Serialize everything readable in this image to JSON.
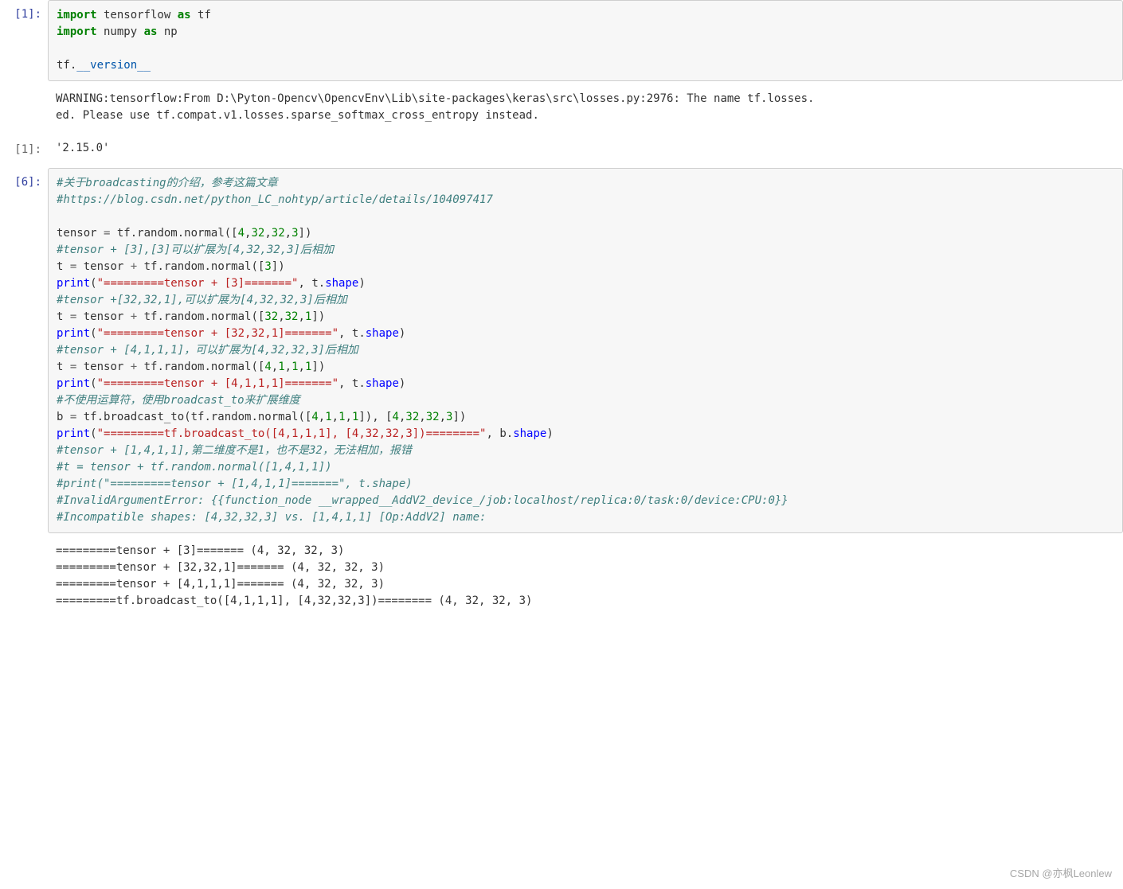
{
  "cells": {
    "c1": {
      "prompt": "[1]:",
      "code": {
        "line1_import": "import",
        "line1_mod": " tensorflow ",
        "line1_as": "as",
        "line1_alias": " tf",
        "line2_import": "import",
        "line2_mod": " numpy ",
        "line2_as": "as",
        "line2_alias": " np",
        "line3_obj": "tf.",
        "line3_dunder": "__version__"
      },
      "stream_output": "WARNING:tensorflow:From D:\\Pyton-Opencv\\OpencvEnv\\Lib\\site-packages\\keras\\src\\losses.py:2976: The name tf.losses.\ned. Please use tf.compat.v1.losses.sparse_softmax_cross_entropy instead.",
      "out_prompt": "[1]:",
      "result": "'2.15.0'"
    },
    "c6": {
      "prompt": "[6]:",
      "out_text": "=========tensor + [3]======= (4, 32, 32, 3)\n=========tensor + [32,32,1]======= (4, 32, 32, 3)\n=========tensor + [4,1,1,1]======= (4, 32, 32, 3)\n=========tf.broadcast_to([4,1,1,1], [4,32,32,3])======== (4, 32, 32, 3)",
      "lines": {
        "cm1": "#关于broadcasting的介绍，参考这篇文章",
        "cm2": "#https://blog.csdn.net/python_LC_nohtyp/article/details/104097417",
        "t1a": "tensor ",
        "t1b": "=",
        "t1c": " tf.random.normal([",
        "t1d": "4",
        "t1e": ",",
        "t1f": "32",
        "t1g": ",",
        "t1h": "32",
        "t1i": ",",
        "t1j": "3",
        "t1k": "])",
        "cm3": "#tensor + [3],[3]可以扩展为[4,32,32,3]后相加",
        "l3a": "t ",
        "l3b": "=",
        "l3c": " tensor ",
        "l3d": "+",
        "l3e": " tf.random.normal([",
        "l3f": "3",
        "l3g": "])",
        "p1a": "print",
        "p1b": "(",
        "p1c": "\"=========tensor + [3]=======\"",
        "p1d": ", t.",
        "p1e": "shape",
        "p1f": ")",
        "cm4": "#tensor +[32,32,1],可以扩展为[4,32,32,3]后相加",
        "l4a": "t ",
        "l4b": "=",
        "l4c": " tensor ",
        "l4d": "+",
        "l4e": " tf.random.normal([",
        "l4f": "32",
        "l4g": ",",
        "l4h": "32",
        "l4i": ",",
        "l4j": "1",
        "l4k": "])",
        "p2a": "print",
        "p2b": "(",
        "p2c": "\"=========tensor + [32,32,1]=======\"",
        "p2d": ", t.",
        "p2e": "shape",
        "p2f": ")",
        "cm5": "#tensor + [4,1,1,1]，可以扩展为[4,32,32,3]后相加",
        "l5a": "t ",
        "l5b": "=",
        "l5c": " tensor ",
        "l5d": "+",
        "l5e": " tf.random.normal([",
        "l5f": "4",
        "l5g": ",",
        "l5h": "1",
        "l5i": ",",
        "l5j": "1",
        "l5k": ",",
        "l5l": "1",
        "l5m": "])",
        "p3a": "print",
        "p3b": "(",
        "p3c": "\"=========tensor + [4,1,1,1]=======\"",
        "p3d": ", t.",
        "p3e": "shape",
        "p3f": ")",
        "cm6": "#不使用运算符，使用broadcast_to来扩展维度",
        "l6a": "b ",
        "l6b": "=",
        "l6c": " tf.broadcast_to(tf.random.normal([",
        "l6d": "4",
        "l6e": ",",
        "l6f": "1",
        "l6g": ",",
        "l6h": "1",
        "l6i": ",",
        "l6j": "1",
        "l6k": "]), [",
        "l6l": "4",
        "l6m": ",",
        "l6n": "32",
        "l6o": ",",
        "l6p": "32",
        "l6q": ",",
        "l6r": "3",
        "l6s": "])",
        "p4a": "print",
        "p4b": "(",
        "p4c": "\"=========tf.broadcast_to([4,1,1,1], [4,32,32,3])========\"",
        "p4d": ", b.",
        "p4e": "shape",
        "p4f": ")",
        "cm7": "#tensor + [1,4,1,1],第二维度不是1，也不是32，无法相加，报错",
        "cm8": "#t = tensor + tf.random.normal([1,4,1,1])",
        "cm9": "#print(\"=========tensor + [1,4,1,1]=======\", t.shape)",
        "cm10": "#InvalidArgumentError: {{function_node __wrapped__AddV2_device_/job:localhost/replica:0/task:0/device:CPU:0}}",
        "cm11": "#Incompatible shapes: [4,32,32,3] vs. [1,4,1,1] [Op:AddV2] name:"
      }
    }
  },
  "watermark": "CSDN @亦枫Leonlew"
}
